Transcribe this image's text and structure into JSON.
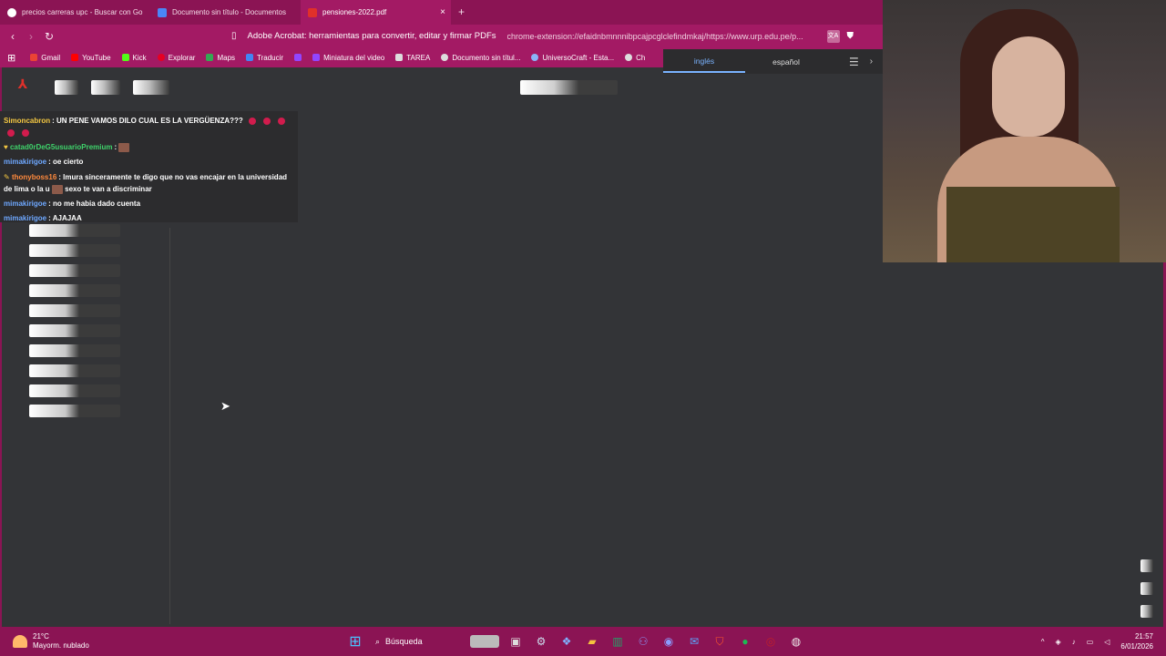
{
  "browser": {
    "tabs": [
      {
        "title": "precios carreras upc - Buscar con Go",
        "icon_color": "#ffffff"
      },
      {
        "title": "Documento sin título - Documentos",
        "icon_color": "#4a86f7"
      },
      {
        "title": "pensiones-2022.pdf",
        "icon_color": "#e0302a",
        "active": true
      }
    ],
    "tab_close": "×",
    "new_tab": "+",
    "site_title": "Adobe Acrobat: herramientas para convertir, editar y firmar PDFs",
    "url": "chrome-extension://efaidnbmnnnibpcajpcglclefindmkaj/https://www.urp.edu.pe/p...",
    "translate_label": "文A"
  },
  "bookmarks": [
    {
      "label": "Gmail",
      "color": "#ea4335"
    },
    {
      "label": "YouTube",
      "color": "#ff0000"
    },
    {
      "label": "Kick",
      "color": "#53fc18"
    },
    {
      "label": "Explorar",
      "color": "#e60023"
    },
    {
      "label": "Maps",
      "color": "#34a853"
    },
    {
      "label": "Traducir",
      "color": "#4285f4"
    },
    {
      "label": "",
      "color": "#9146ff"
    },
    {
      "label": "Miniatura del video",
      "color": "#9146ff"
    },
    {
      "label": "TAREA",
      "color": "#dddddd"
    },
    {
      "label": "Documento sin títul...",
      "color": "#dddddd"
    },
    {
      "label": "UniversoCraft - Esta...",
      "color": "#8ab4f8"
    },
    {
      "label": "Ch",
      "color": "#dddddd"
    }
  ],
  "translate_popup": {
    "from": "inglés",
    "to": "español"
  },
  "chat": {
    "messages": [
      {
        "user": "Simoncabron",
        "user_color": "#f5c842",
        "text": ": UN PENE VAMOS DILO CUAL ES LA VERGÜENZA???"
      },
      {
        "user": "catad0rDeG5usuarioPremium",
        "user_color": "#3fd36b",
        "text": ":"
      },
      {
        "user": "mimakirigoe",
        "user_color": "#6ea8ff",
        "text": ": oe cierto"
      },
      {
        "user": "thonyboss16",
        "user_color": "#ff8a3d",
        "text": ": lmura sinceramente te digo que no vas encajar en la universidad de lima o la u",
        "text2": "sexo te van a discriminar"
      },
      {
        "user": "mimakirigoe",
        "user_color": "#6ea8ff",
        "text": ": no me habia dado cuenta"
      },
      {
        "user": "mimakirigoe",
        "user_color": "#6ea8ff",
        "text": ": AJAJAA"
      }
    ]
  },
  "taskbar": {
    "temperature": "21°C",
    "weather": "Mayorm. nublado",
    "search": "Búsqueda",
    "time": "21:57",
    "date": "6/01/2026"
  }
}
